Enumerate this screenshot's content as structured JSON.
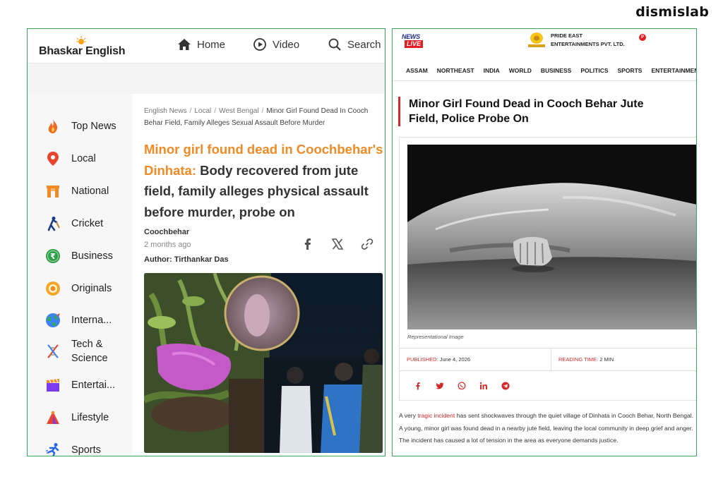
{
  "brand": "dismislab",
  "left_site": {
    "logo_text": "Bhaskar English",
    "nav": [
      {
        "label": "Home",
        "icon": "home-icon"
      },
      {
        "label": "Video",
        "icon": "play-circle-icon"
      },
      {
        "label": "Search",
        "icon": "search-icon"
      }
    ],
    "sidebar": [
      {
        "label": "Top News",
        "icon": "flame-icon"
      },
      {
        "label": "Local",
        "icon": "location-pin-icon"
      },
      {
        "label": "National",
        "icon": "india-gate-icon"
      },
      {
        "label": "Cricket",
        "icon": "cricket-player-icon"
      },
      {
        "label": "Business",
        "icon": "rupee-coin-icon"
      },
      {
        "label": "Originals",
        "icon": "originals-badge-icon"
      },
      {
        "label": "Interna...",
        "icon": "globe-icon"
      },
      {
        "label": "Tech &",
        "label2": "Science",
        "icon": "dna-icon"
      },
      {
        "label": "Entertai...",
        "icon": "clapperboard-icon"
      },
      {
        "label": "Lifestyle",
        "icon": "lifestyle-icon"
      },
      {
        "label": "Sports",
        "icon": "runner-icon"
      }
    ],
    "breadcrumb": {
      "items": [
        "English News",
        "Local",
        "West Bengal"
      ],
      "current": "Minor Girl Found Dead In Cooch Behar Field, Family Alleges Sexual Assault Before Murder"
    },
    "headline_highlight": "Minor girl found dead in Coochbehar's Dinhata:",
    "headline_rest": " Body recovered from jute field, family alleges physical assault before murder, probe on",
    "location": "Coochbehar",
    "time": "2 months ago",
    "author": "Author: Tirthankar Das",
    "share_icons": [
      "facebook-icon",
      "x-icon",
      "link-icon"
    ]
  },
  "right_site": {
    "logo_top": "NEWS",
    "logo_bottom": "LIVE",
    "partner_line1": "PRIDE EAST",
    "partner_line2": "ENTERTAINMENTS PVT. LTD.",
    "partner_badge": "P",
    "nav": [
      "ASSAM",
      "NORTHEAST",
      "INDIA",
      "WORLD",
      "BUSINESS",
      "POLITICS",
      "SPORTS",
      "ENTERTAINMENT"
    ],
    "title": "Minor Girl Found Dead in Cooch Behar Jute Field, Police Probe On",
    "caption": "Representational Image",
    "published_label": "PUBLISHED:",
    "published_value": " June 4, 2026",
    "reading_label": "READING TIME:",
    "reading_value": " 2 MIN",
    "share_icons": [
      "facebook-icon",
      "twitter-icon",
      "whatsapp-icon",
      "linkedin-icon",
      "telegram-icon"
    ],
    "body_pre": "A very ",
    "body_link": "tragic incident",
    "body_post": " has sent shockwaves through the quiet village of Dinhata in Cooch Behar, North Bengal. A young, minor girl was found dead in a nearby jute field, leaving the local community in deep grief and anger. The incident has caused a lot of tension in the area as everyone demands justice."
  },
  "colors": {
    "accent_orange": "#f08a24",
    "accent_red": "#d42a2a",
    "panel_border": "#3aa95a"
  }
}
